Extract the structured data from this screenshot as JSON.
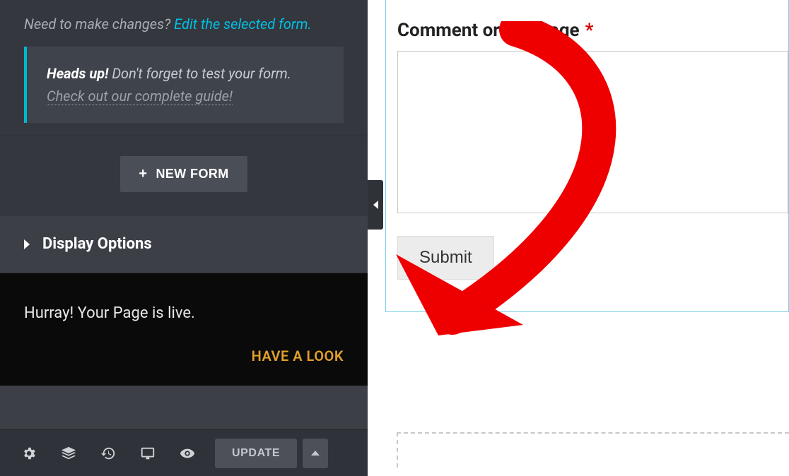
{
  "sidebar": {
    "hint_prefix": "Need to make changes? ",
    "hint_link": "Edit the selected form.",
    "heads_up_strong": "Heads up!",
    "heads_up_text": " Don't forget to test your form. ",
    "heads_up_link": "Check out our complete guide!",
    "new_form_label": "NEW FORM",
    "display_options_label": "Display Options",
    "live_message": "Hurray! Your Page is live.",
    "have_a_look": "HAVE A LOOK",
    "update_label": "UPDATE"
  },
  "preview": {
    "field_label": "Comment or Message",
    "required_mark": "*",
    "submit_label": "Submit"
  },
  "icons": {
    "settings": "gear-icon",
    "layers": "layers-icon",
    "history": "history-icon",
    "responsive": "monitor-icon",
    "preview": "eye-icon"
  }
}
